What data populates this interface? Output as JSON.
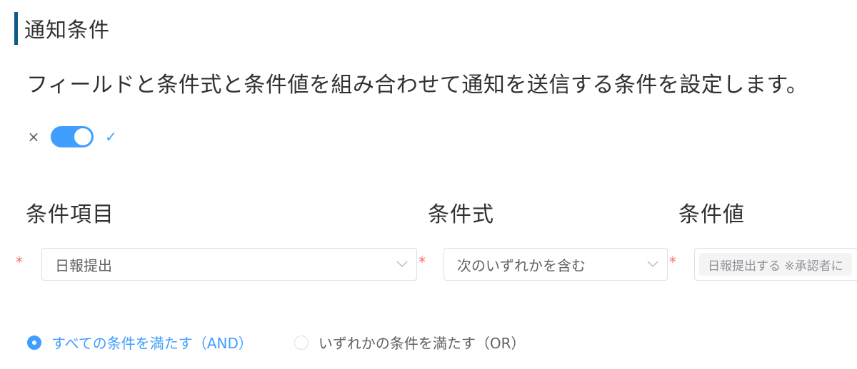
{
  "section": {
    "title": "通知条件",
    "description": "フィールドと条件式と条件値を組み合わせて通知を送信する条件を設定します。"
  },
  "switch": {
    "off_icon": "×",
    "on_icon": "✓",
    "enabled": true,
    "active_color": "#409eff"
  },
  "columns": {
    "field_label": "条件項目",
    "operator_label": "条件式",
    "value_label": "条件値"
  },
  "condition": {
    "required_mark": "*",
    "field_value": "日報提出",
    "operator_value": "次のいずれかを含む",
    "value_tags": [
      "日報提出する ※承認者に"
    ]
  },
  "match_mode": {
    "options": [
      {
        "label": "すべての条件を満たす（AND）",
        "checked": true
      },
      {
        "label": "いずれかの条件を満たす（OR）",
        "checked": false
      }
    ]
  },
  "colors": {
    "accent": "#409eff",
    "title_bar": "#0e5a8a",
    "required": "#f56c6c",
    "border": "#dcdfe6"
  },
  "icons": {
    "select_arrow": "chevron-down-icon"
  }
}
